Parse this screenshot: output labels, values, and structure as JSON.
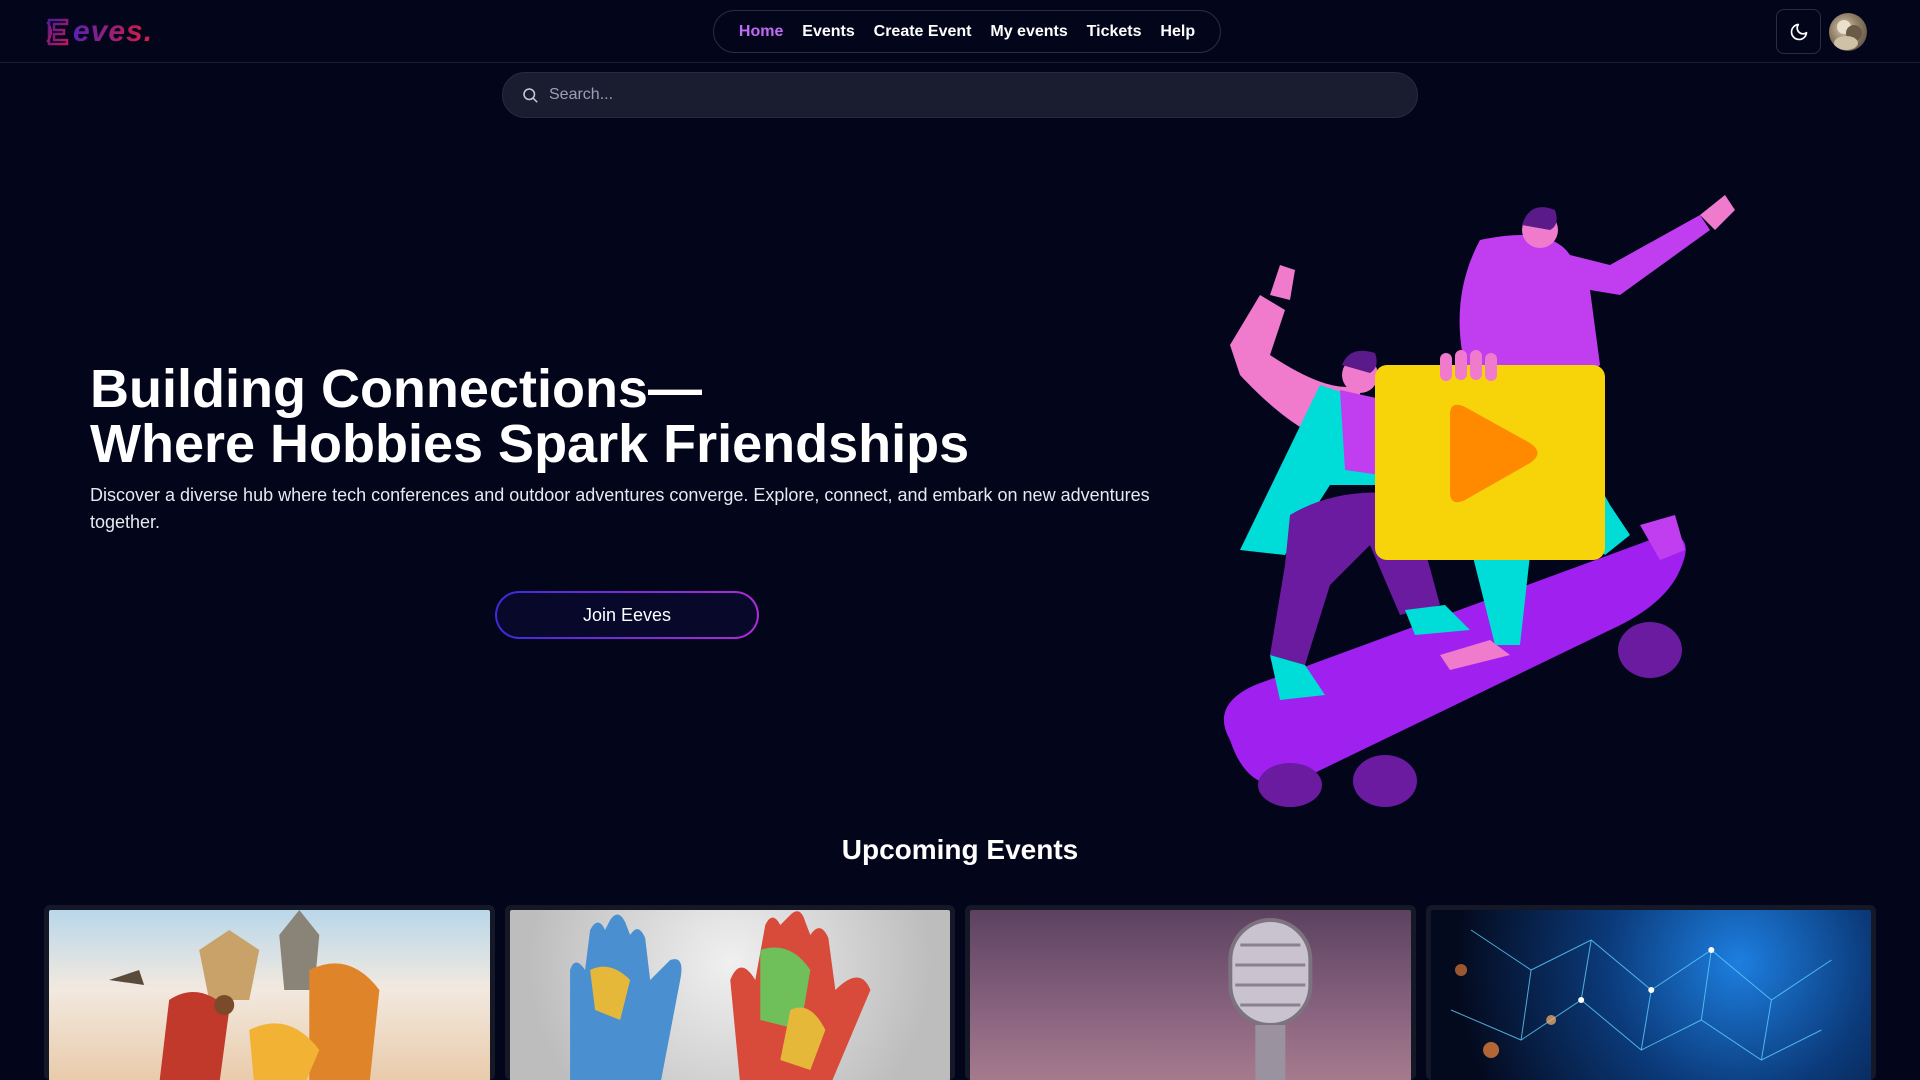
{
  "app": {
    "logo_text": "eves."
  },
  "nav": {
    "items": [
      {
        "label": "Home",
        "active": true
      },
      {
        "label": "Events"
      },
      {
        "label": "Create Event"
      },
      {
        "label": "My events"
      },
      {
        "label": "Tickets"
      },
      {
        "label": "Help"
      }
    ]
  },
  "header": {
    "theme_icon": "moon-icon",
    "avatar_icon": "user-avatar"
  },
  "search": {
    "placeholder": "Search...",
    "icon": "search-icon"
  },
  "hero": {
    "title_line1": "Building Connections—",
    "title_line2": "Where Hobbies Spark Friendships",
    "description": "Discover a diverse hub where tech conferences and outdoor adventures converge. Explore, connect, and embark on new adventures together.",
    "cta_label": "Join Eeves"
  },
  "upcoming": {
    "title": "Upcoming Events",
    "cards": [
      {
        "image": "cultural-dance-collage"
      },
      {
        "image": "world-map-hands"
      },
      {
        "image": "microphone"
      },
      {
        "image": "network-technology"
      }
    ]
  },
  "colors": {
    "background": "#03051a",
    "accent": "#c06cf2",
    "brand_gradient_start": "#5b21b6",
    "brand_gradient_end": "#e11d48"
  }
}
